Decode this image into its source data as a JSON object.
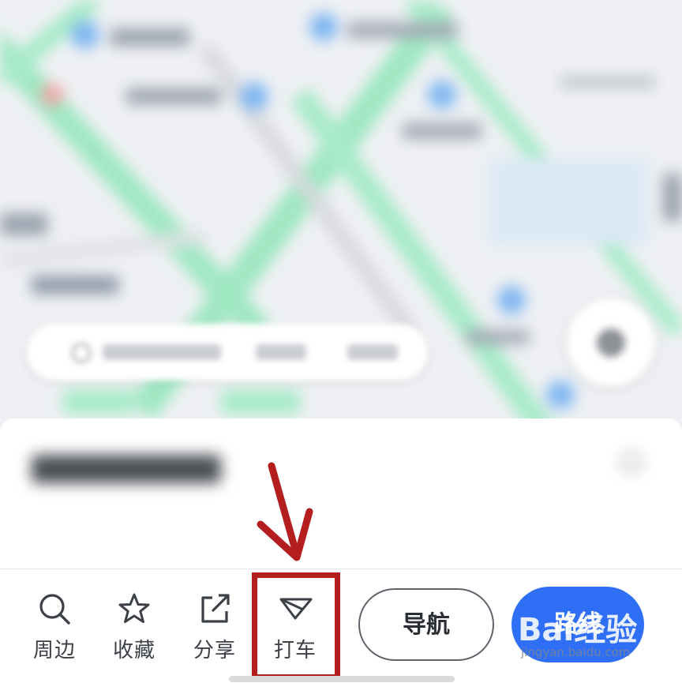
{
  "colors": {
    "accent": "#2f6ff5",
    "highlight": "#b51e1e",
    "icon": "#3c4047",
    "map_green": "#8fe3b8"
  },
  "toolbar": {
    "items": [
      {
        "label": "周边",
        "icon": "search-icon"
      },
      {
        "label": "收藏",
        "icon": "star-icon"
      },
      {
        "label": "分享",
        "icon": "share-icon"
      },
      {
        "label": "打车",
        "icon": "taxi-icon"
      }
    ],
    "navigate_label": "导航",
    "route_label": "路线"
  },
  "watermark": {
    "brand": "Bai经验",
    "url": "jingyan.baidu.com"
  }
}
